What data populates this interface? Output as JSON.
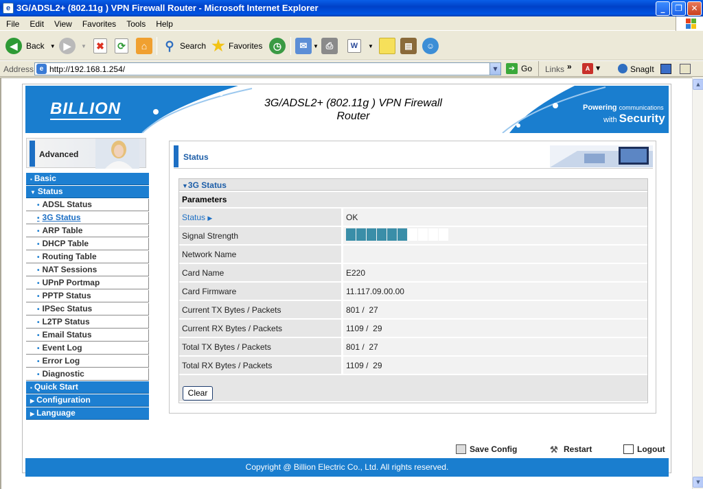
{
  "window": {
    "title": "3G/ADSL2+ (802.11g ) VPN Firewall Router - Microsoft Internet Explorer",
    "minimize": "_",
    "maximize": "❐",
    "close": "✕"
  },
  "menu": [
    "File",
    "Edit",
    "View",
    "Favorites",
    "Tools",
    "Help"
  ],
  "toolbar": {
    "back": "Back",
    "search": "Search",
    "favorites": "Favorites"
  },
  "addressbar": {
    "label": "Address",
    "url": "http://192.168.1.254/",
    "go": "Go",
    "links": "Links",
    "snagit": "SnagIt"
  },
  "banner": {
    "logo": "BILLION",
    "product_line1": "3G/ADSL2+ (802.11g ) VPN Firewall",
    "product_line2": "Router",
    "tagline_powering": "Powering",
    "tagline_communications": "communications",
    "tagline_with": "with",
    "tagline_security": "Security"
  },
  "nav": {
    "mode_label": "Advanced",
    "basic": "Basic",
    "status": "Status",
    "status_items": [
      "ADSL Status",
      "3G Status",
      "ARP Table",
      "DHCP Table",
      "Routing Table",
      "NAT Sessions",
      "UPnP Portmap",
      "PPTP Status",
      "IPSec Status",
      "L2TP Status",
      "Email Status",
      "Event Log",
      "Error Log",
      "Diagnostic"
    ],
    "active_item": "3G Status",
    "quick_start": "Quick Start",
    "configuration": "Configuration",
    "language": "Language"
  },
  "content": {
    "heading": "Status",
    "section_title": "3G Status",
    "params_label": "Parameters",
    "rows": [
      {
        "key": "Status",
        "value": "OK"
      },
      {
        "key": "Signal Strength",
        "value": ""
      },
      {
        "key": "Network Name",
        "value": ""
      },
      {
        "key": "Card Name",
        "value": "E220"
      },
      {
        "key": "Card Firmware",
        "value": "11.117.09.00.00"
      },
      {
        "key": "Current TX Bytes / Packets",
        "value": "801 /  27"
      },
      {
        "key": "Current RX Bytes / Packets",
        "value": "1109 /  29"
      },
      {
        "key": "Total TX Bytes / Packets",
        "value": "801 /  27"
      },
      {
        "key": "Total RX Bytes / Packets",
        "value": "1109 /  29"
      }
    ],
    "signal_bars_total": 10,
    "signal_bars_on": 6,
    "clear_button": "Clear"
  },
  "actions": {
    "save": "Save Config",
    "restart": "Restart",
    "logout": "Logout"
  },
  "footer": "Copyright @ Billion Electric Co., Ltd. All rights reserved.",
  "colors": {
    "brand_blue": "#1d7fd1",
    "signal_on": "#3a8ea8"
  }
}
